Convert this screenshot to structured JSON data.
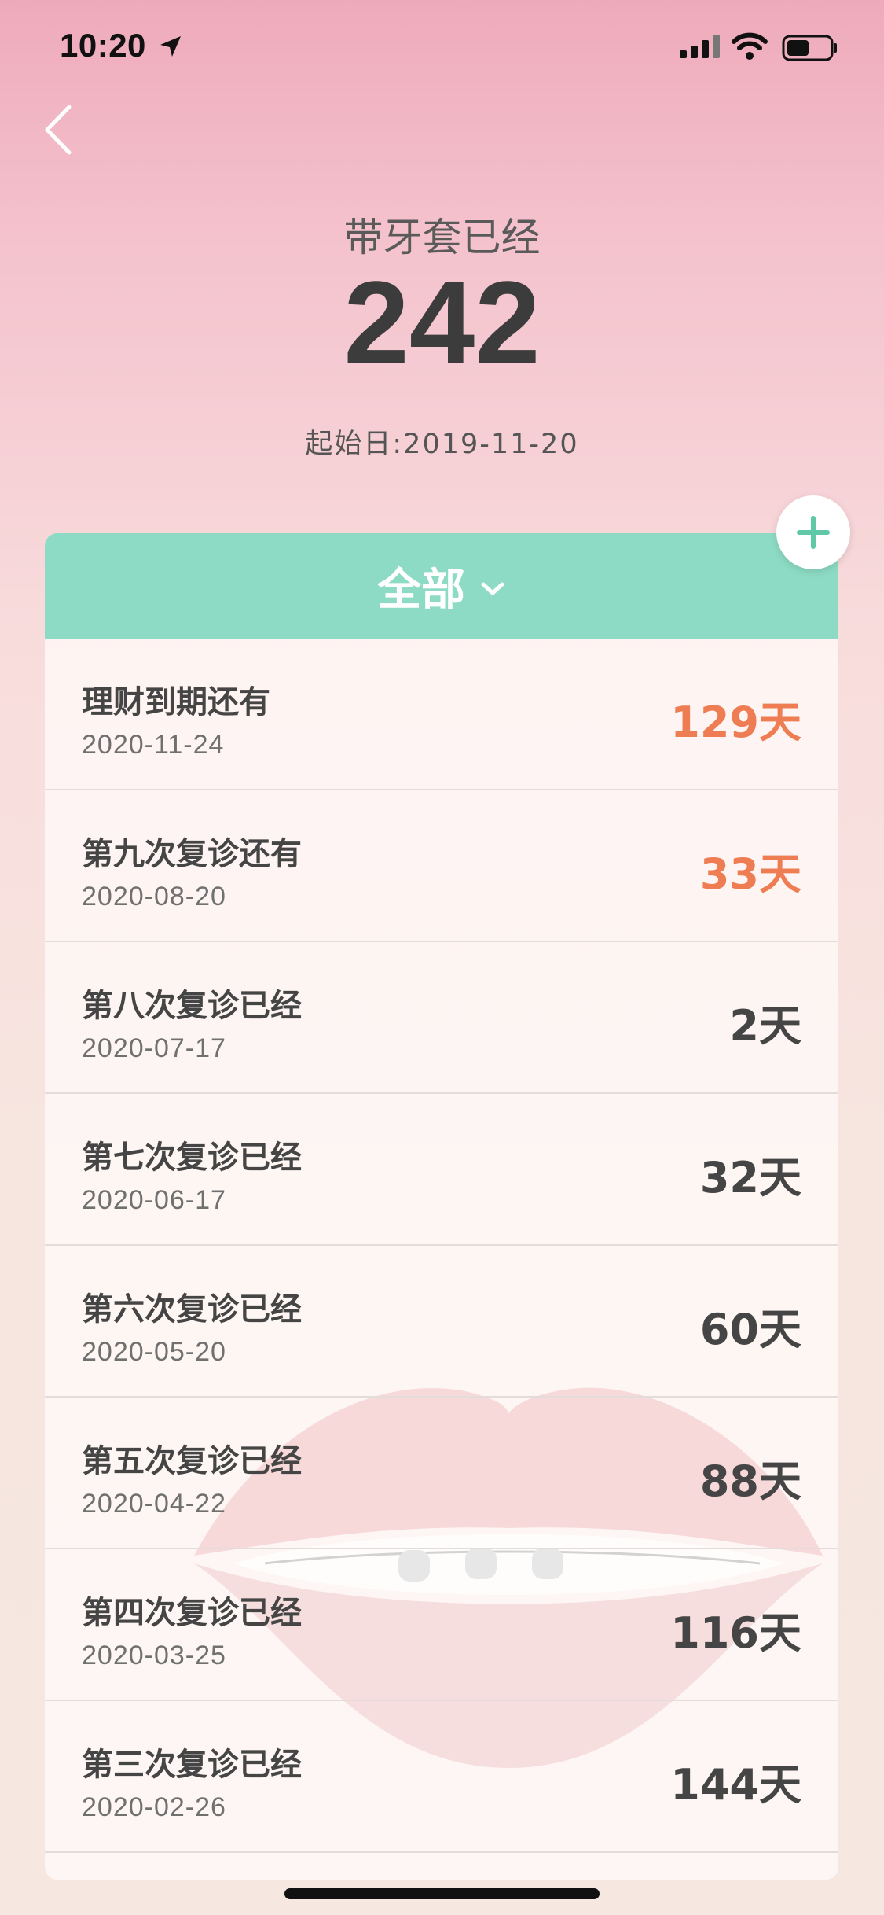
{
  "status_bar": {
    "time": "10:20"
  },
  "header": {
    "subtitle": "带牙套已经",
    "count": "242",
    "start_date": "起始日:2019-11-20"
  },
  "filter": {
    "label": "全部"
  },
  "rows": [
    {
      "title": "理财到期还有",
      "date": "2020-11-24",
      "days": "129天",
      "future": true
    },
    {
      "title": "第九次复诊还有",
      "date": "2020-08-20",
      "days": "33天",
      "future": true
    },
    {
      "title": "第八次复诊已经",
      "date": "2020-07-17",
      "days": "2天",
      "future": false
    },
    {
      "title": "第七次复诊已经",
      "date": "2020-06-17",
      "days": "32天",
      "future": false
    },
    {
      "title": "第六次复诊已经",
      "date": "2020-05-20",
      "days": "60天",
      "future": false
    },
    {
      "title": "第五次复诊已经",
      "date": "2020-04-22",
      "days": "88天",
      "future": false
    },
    {
      "title": "第四次复诊已经",
      "date": "2020-03-25",
      "days": "116天",
      "future": false
    },
    {
      "title": "第三次复诊已经",
      "date": "2020-02-26",
      "days": "144天",
      "future": false
    }
  ],
  "colors": {
    "header_bar": "#8ddbc4",
    "future_days": "#ee7d53",
    "past_days": "#454545",
    "add_icon": "#5fc9a7"
  },
  "icons": {
    "back": "chevron-left-icon",
    "dropdown": "chevron-down-icon",
    "add": "plus-icon"
  }
}
